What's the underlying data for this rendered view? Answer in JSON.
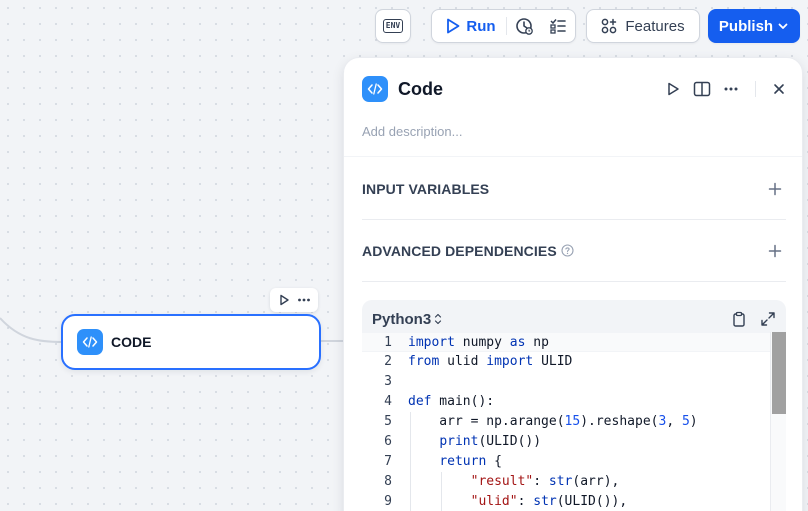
{
  "toolbar": {
    "env_label": "ENV",
    "run_label": "Run",
    "features_label": "Features",
    "publish_label": "Publish"
  },
  "canvas": {
    "node_label": "CODE"
  },
  "panel": {
    "title": "Code",
    "description_placeholder": "Add description...",
    "sections": {
      "input_variables": "INPUT VARIABLES",
      "advanced_dependencies": "ADVANCED DEPENDENCIES"
    },
    "editor": {
      "language": "Python3",
      "line_numbers": [
        "1",
        "2",
        "3",
        "4",
        "5",
        "6",
        "7",
        "8",
        "9"
      ]
    }
  },
  "colors": {
    "accent": "#155eef",
    "node_border": "#2970ff",
    "code_badge": "#2e90fa"
  }
}
